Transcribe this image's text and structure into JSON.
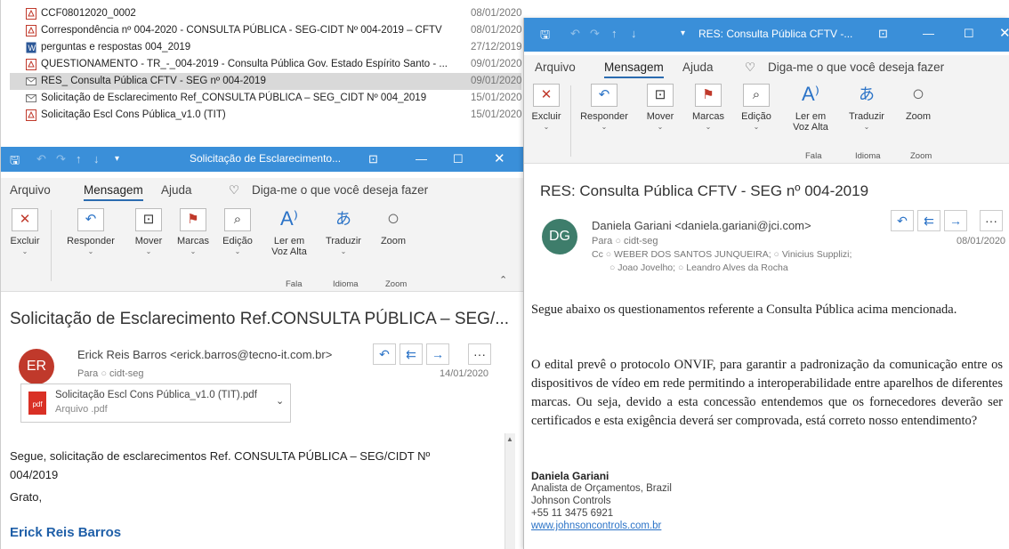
{
  "file_list": {
    "rows": [
      {
        "name": "CCF08012020_0002",
        "date": "08/01/2020",
        "icon": "pdf-icon"
      },
      {
        "name": "Correspondência nº 004-2020 - CONSULTA PÚBLICA - SEG-CIDT Nº 004-2019 – CFTV",
        "date": "08/01/2020",
        "icon": "pdf-icon"
      },
      {
        "name": "perguntas e respostas 004_2019",
        "date": "27/12/2019",
        "icon": "word-icon"
      },
      {
        "name": "QUESTIONAMENTO - TR_-_004-2019 - Consulta Pública Gov. Estado Espírito Santo - ...",
        "date": "09/01/2020",
        "icon": "pdf-icon"
      },
      {
        "name": "RES_ Consulta Pública CFTV - SEG nº 004-2019",
        "date": "09/01/2020",
        "icon": "mail-icon"
      },
      {
        "name": "Solicitação de Esclarecimento Ref_CONSULTA PÚBLICA – SEG_CIDT Nº 004_2019",
        "date": "15/01/2020",
        "icon": "mail-icon"
      },
      {
        "name": "Solicitação Escl Cons Pública_v1.0 (TIT)",
        "date": "15/01/2020",
        "icon": "pdf-icon"
      }
    ]
  },
  "left_window": {
    "title": "Solicitação de Esclarecimento...",
    "menu": {
      "arquivo": "Arquivo",
      "mensagem": "Mensagem",
      "ajuda": "Ajuda",
      "tell_me": "Diga-me o que você deseja fazer"
    },
    "ribbon": {
      "excluir": "Excluir",
      "responder": "Responder",
      "mover": "Mover",
      "marcas": "Marcas",
      "edicao": "Edição",
      "ler1": "Ler em",
      "ler2": "Voz Alta",
      "traduzir": "Traduzir",
      "zoom": "Zoom",
      "grp_fala": "Fala",
      "grp_idioma": "Idioma",
      "grp_zoom": "Zoom"
    },
    "subject": "Solicitação de Esclarecimento Ref.CONSULTA PÚBLICA – SEG/...",
    "avatar": "ER",
    "from": "Erick Reis Barros <erick.barros@tecno-it.com.br>",
    "to_label": "Para",
    "to": "cidt-seg",
    "date": "14/01/2020",
    "attachment": {
      "name": "Solicitação Escl Cons Pública_v1.0 (TIT).pdf",
      "type": "Arquivo .pdf"
    },
    "body1": "Segue, solicitação de esclarecimentos Ref. CONSULTA PÚBLICA – SEG/CIDT Nº 004/2019",
    "body2": "Grato,",
    "signature": "Erick Reis Barros"
  },
  "right_window": {
    "title": "RES: Consulta Pública CFTV -...",
    "menu": {
      "arquivo": "Arquivo",
      "mensagem": "Mensagem",
      "ajuda": "Ajuda",
      "tell_me": "Diga-me o que você deseja fazer"
    },
    "ribbon": {
      "excluir": "Excluir",
      "responder": "Responder",
      "mover": "Mover",
      "marcas": "Marcas",
      "edicao": "Edição",
      "ler1": "Ler em",
      "ler2": "Voz Alta",
      "traduzir": "Traduzir",
      "zoom": "Zoom",
      "grp_fala": "Fala",
      "grp_idioma": "Idioma",
      "grp_zoom": "Zoom"
    },
    "subject": "RES: Consulta Pública CFTV - SEG nº 004-2019",
    "avatar": "DG",
    "from": "Daniela Gariani <daniela.gariani@jci.com>",
    "to_label": "Para",
    "to": "cidt-seg",
    "date": "08/01/2020",
    "cc_label": "Cc",
    "cc1": "WEBER DOS SANTOS JUNQUEIRA;",
    "cc2": "Vinicius Supplizi;",
    "cc3": "Joao Jovelho;",
    "cc4": "Leandro Alves da Rocha",
    "para1": "Segue abaixo os questionamentos referente a Consulta Pública acima mencionada.",
    "para2": "O edital prevê o protocolo ONVIF, para garantir a padronização da comunicação entre os dispositivos de vídeo em rede permitindo a interoperabilidade entre aparelhos de diferentes marcas. Ou seja, devido a esta concessão entendemos que os fornecedores deverão ser certificados e esta exigência deverá ser comprovada, está correto nosso entendimento?",
    "sig_name": "Daniela Gariani",
    "sig_title": "Analista de Orçamentos, Brazil",
    "sig_company": "Johnson Controls",
    "sig_phone": "+55 11 3475 6921",
    "sig_web": "www.johnsoncontrols.com.br"
  },
  "colors": {
    "titlebar": "#3a8fd9",
    "avatar_er": "#c0392b",
    "avatar_dg": "#3e7d6b",
    "accent": "#2b73c7"
  }
}
